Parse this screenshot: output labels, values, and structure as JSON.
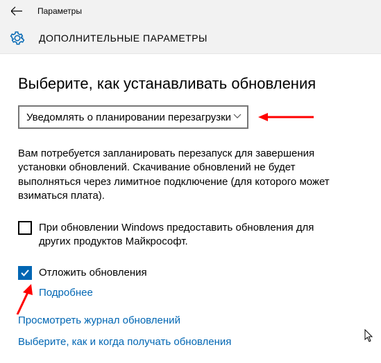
{
  "header": {
    "window_title": "Параметры",
    "page_title": "ДОПОЛНИТЕЛЬНЫЕ ПАРАМЕТРЫ"
  },
  "main": {
    "heading": "Выберите, как устанавливать обновления",
    "dropdown_value": "Уведомлять о планировании перезагрузки",
    "description": "Вам потребуется запланировать перезапуск для завершения установки обновлений. Скачивание обновлений не будет выполняться через лимитное подключение (для которого может взиматься плата).",
    "cb_other_products": "При обновлении Windows предоставить обновления для других продуктов Майкрософт.",
    "cb_defer": "Отложить обновления",
    "learn_more": "Подробнее",
    "link_history": "Просмотреть журнал обновлений",
    "link_delivery": "Выберите, как и когда получать обновления"
  }
}
